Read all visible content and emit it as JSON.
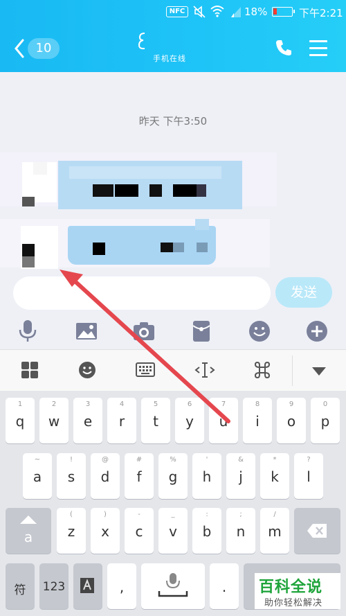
{
  "status_bar": {
    "nfc": "NFC",
    "battery": "18%",
    "time": "下午2:21"
  },
  "header": {
    "back_count": "10",
    "subtitle": "手机在线"
  },
  "chat": {
    "timestamp": "昨天 下午3:50"
  },
  "input": {
    "placeholder": "",
    "send_label": "发送"
  },
  "tools": [
    "mic-icon",
    "image-icon",
    "camera-icon",
    "red-packet-icon",
    "emoji-icon",
    "plus-icon"
  ],
  "keyboard": {
    "row1": [
      {
        "hint": "1",
        "key": "q"
      },
      {
        "hint": "2",
        "key": "w"
      },
      {
        "hint": "3",
        "key": "e"
      },
      {
        "hint": "4",
        "key": "r"
      },
      {
        "hint": "5",
        "key": "t"
      },
      {
        "hint": "6",
        "key": "y"
      },
      {
        "hint": "7",
        "key": "u"
      },
      {
        "hint": "8",
        "key": "i"
      },
      {
        "hint": "9",
        "key": "o"
      },
      {
        "hint": "0",
        "key": "p"
      }
    ],
    "row2": [
      {
        "hint": "~",
        "key": "a"
      },
      {
        "hint": "!",
        "key": "s"
      },
      {
        "hint": "@",
        "key": "d"
      },
      {
        "hint": "#",
        "key": "f"
      },
      {
        "hint": "%",
        "key": "g"
      },
      {
        "hint": "'",
        "key": "h"
      },
      {
        "hint": "&",
        "key": "j"
      },
      {
        "hint": "*",
        "key": "k"
      },
      {
        "hint": "?",
        "key": "l"
      }
    ],
    "row3": [
      {
        "hint": "(",
        "key": "z"
      },
      {
        "hint": ")",
        "key": "x"
      },
      {
        "hint": "-",
        "key": "c"
      },
      {
        "hint": "_",
        "key": "v"
      },
      {
        "hint": ":",
        "key": "b"
      },
      {
        "hint": ";",
        "key": "n"
      },
      {
        "hint": "/",
        "key": "m"
      }
    ],
    "shift_label": "a",
    "fu_label": "符",
    "num_label": "123",
    "comma": ",",
    "period": "."
  },
  "watermark": {
    "title": "百科全说",
    "subtitle": "助你轻松解决"
  },
  "colors": {
    "header": "#1ec3f7",
    "send_button": "#b9e8f9",
    "arrow": "#e5474e"
  }
}
